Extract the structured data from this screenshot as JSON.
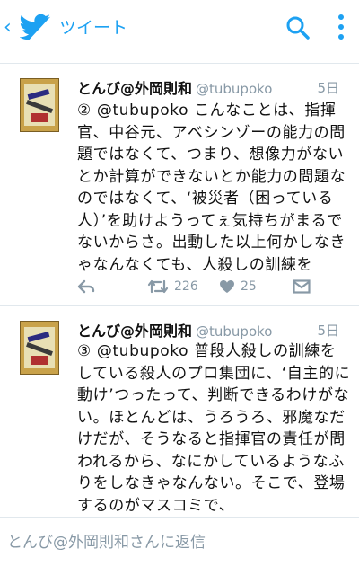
{
  "appbar": {
    "title": "ツイート",
    "accent": "#1da1f2"
  },
  "tweets": [
    {
      "name": "とんび@外岡則和",
      "handle": "@tubupoko",
      "date": "5日",
      "text": "② @tubupoko こんなことは、指揮官、中谷元、アベシンゾーの能力の問題ではなくて、つまり、想像力がないとか計算ができないとか能力の問題なのではなくて、‘被災者（困っている人）’を助けようってぇ気持ちがまるでないからさ。出動した以上何かしなきゃなんなくても、人殺しの訓練を",
      "retweets": "226",
      "likes": "25"
    },
    {
      "name": "とんび@外岡則和",
      "handle": "@tubupoko",
      "date": "5日",
      "text": "③ @tubupoko 普段人殺しの訓練をしている殺人のプロ集団に、‘自主的に動け’つったって、判断できるわけがない。ほとんどは、うろうろ、邪魔なだけだが、そうなると指揮官の責任が問われるから、なにかしているようなふりをしなきゃなんない。そこで、登場するのがマスコミで、"
    }
  ],
  "reply": {
    "placeholder": "とんび@外岡則和さんに返信"
  },
  "icons": [
    "back-chevron-icon",
    "twitter-bird-icon",
    "search-icon",
    "more-vertical-icon",
    "reply-icon",
    "retweet-icon",
    "heart-icon",
    "direct-message-icon"
  ]
}
